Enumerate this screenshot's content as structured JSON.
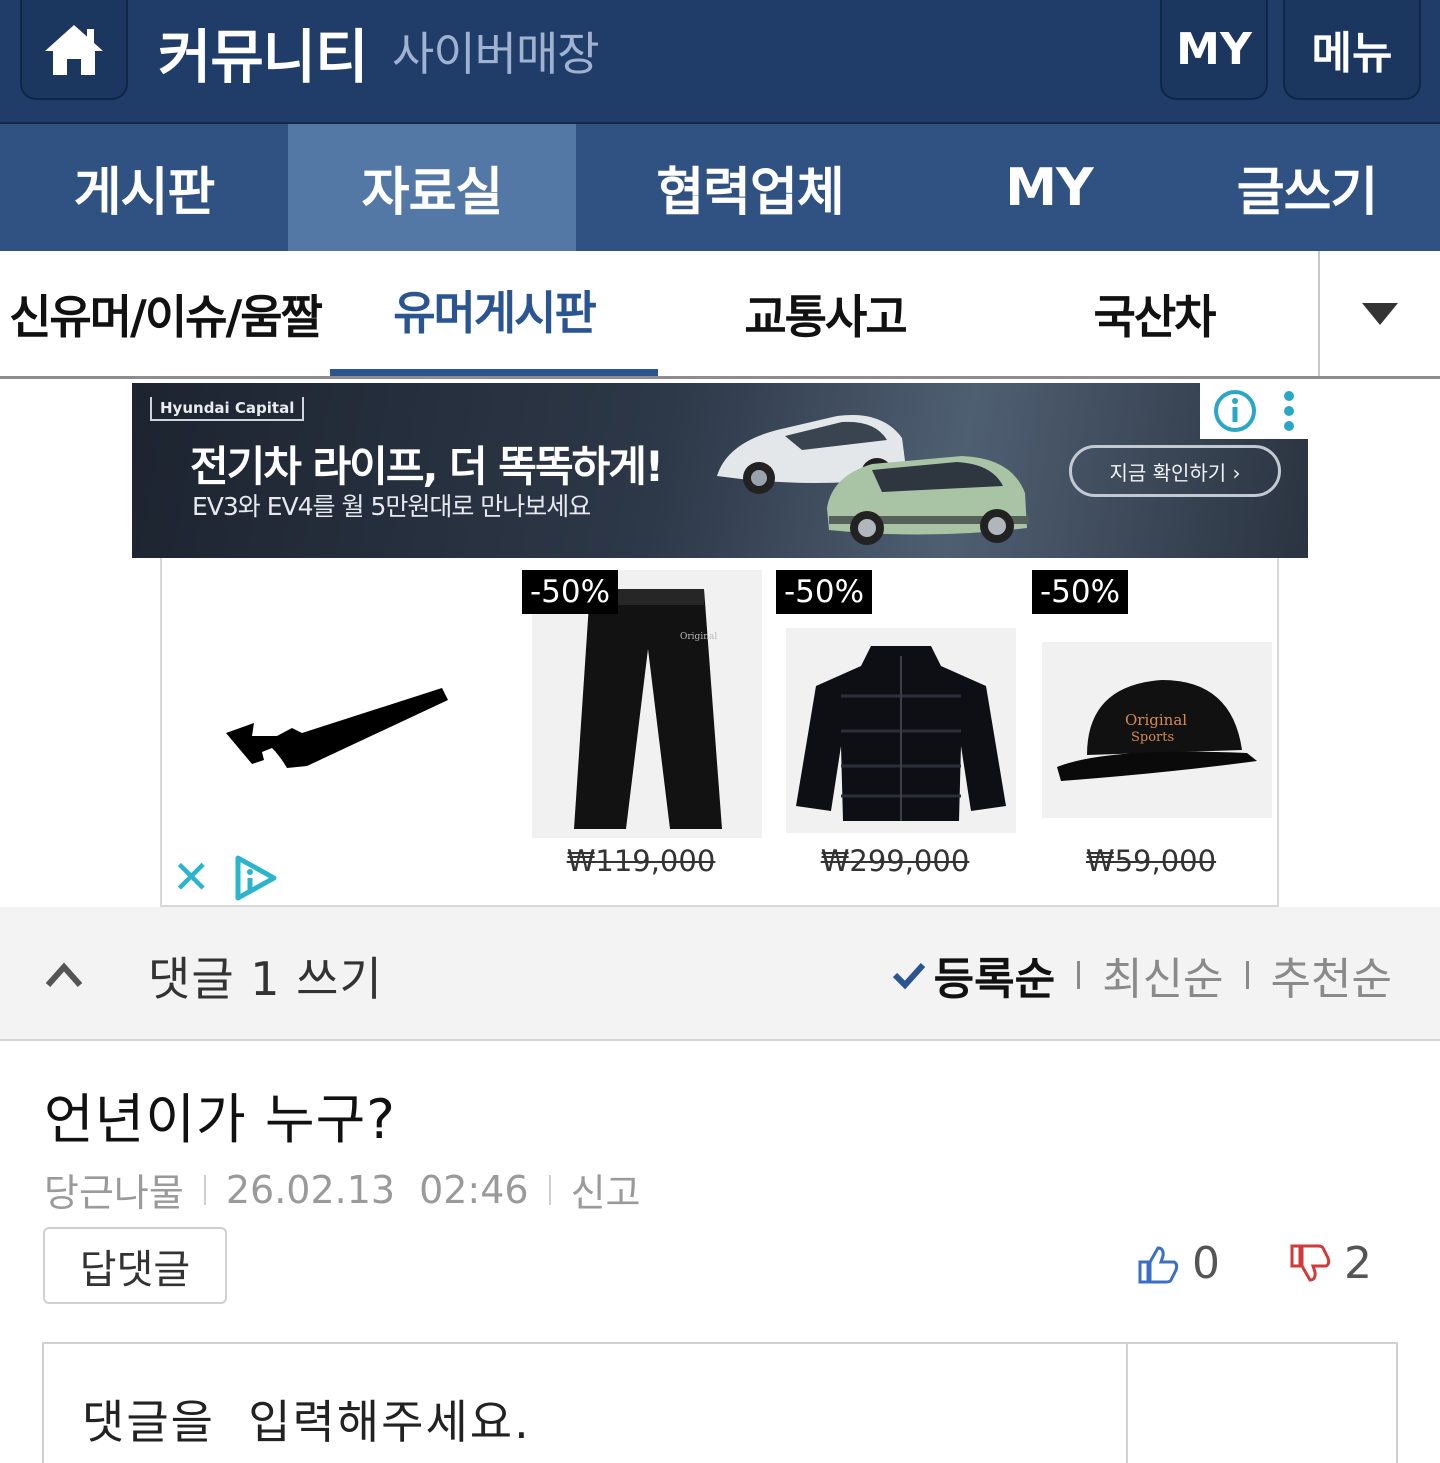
{
  "header": {
    "title": "커뮤니티",
    "subtitle": "사이버매장",
    "my_label": "MY",
    "menu_label": "메뉴",
    "bg_color": "#1f3d68"
  },
  "main_nav": {
    "tabs": [
      {
        "label": "게시판",
        "active": false
      },
      {
        "label": "자료실",
        "active": true
      },
      {
        "label": "협력업체",
        "active": false
      },
      {
        "label": "MY",
        "active": false
      },
      {
        "label": "글쓰기",
        "active": false
      }
    ],
    "active_color": "#5378a6"
  },
  "sub_nav": {
    "items": [
      {
        "label": "신유머/이슈/움짤",
        "active": false
      },
      {
        "label": "유머게시판",
        "active": true
      },
      {
        "label": "교통사고",
        "active": false
      },
      {
        "label": "국산차",
        "active": false
      }
    ],
    "accent_color": "#2a5591",
    "dropdown_icon": "caret-down-icon"
  },
  "banner_ad": {
    "brand": "Hyundai Capital",
    "headline": "전기차 라이프, 더 똑똑하게!",
    "subline": "EV3와 EV4를 월 5만원대로 만나보세요",
    "cta": "지금 확인하기 ›"
  },
  "product_ad": {
    "products": [
      {
        "discount": "-50%",
        "price": "₩119,000",
        "kind": "pants"
      },
      {
        "discount": "-50%",
        "price": "₩299,000",
        "kind": "puffer-jacket"
      },
      {
        "discount": "-50%",
        "price": "₩59,000",
        "kind": "cap"
      }
    ],
    "close_icon": "close-icon",
    "adchoices_icon": "adchoices-icon"
  },
  "comments_bar": {
    "write_label": "댓글 1 쓰기",
    "sort_options": [
      "등록순",
      "최신순",
      "추천순"
    ],
    "selected_sort": "등록순"
  },
  "comment": {
    "text": "언년이가 누구?",
    "author": "당근나물",
    "date": "26.02.13",
    "time": "02:46",
    "report_label": "신고",
    "reply_label": "답댓글",
    "likes": "0",
    "dislikes": "2"
  },
  "comment_input": {
    "placeholder": "댓글을  입력해주세요."
  }
}
